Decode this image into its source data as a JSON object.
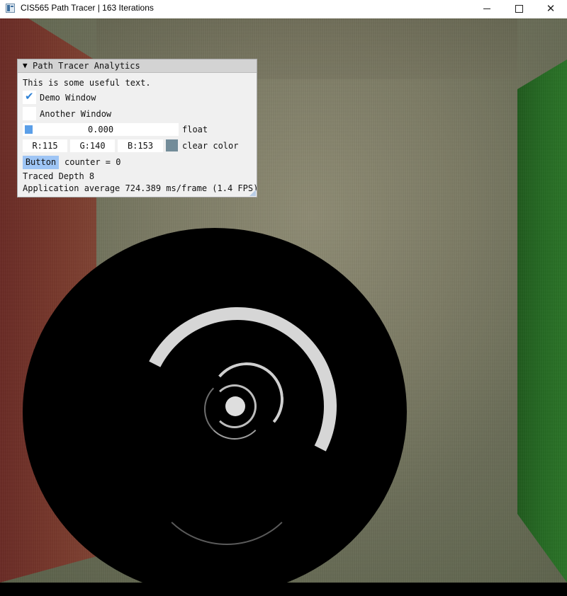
{
  "window": {
    "title": "CIS565 Path Tracer | 163 Iterations",
    "controls": {
      "minimize": "",
      "maximize": "",
      "close": "✕"
    }
  },
  "panel": {
    "title": "Path Tracer Analytics",
    "text": "This is some useful text.",
    "demo_window": {
      "label": "Demo Window",
      "checked": true
    },
    "another_window": {
      "label": "Another Window",
      "checked": false
    },
    "slider": {
      "value": "0.000",
      "label": "float"
    },
    "clear_color": {
      "r": "R:115",
      "g": "G:140",
      "b": "B:153",
      "label": "clear color",
      "swatch": "#738c99"
    },
    "button_label": "Button",
    "counter_text": "counter = 0",
    "traced_depth": "Traced Depth 8",
    "fps_text": "Application average 724.389 ms/frame (1.4 FPS)"
  },
  "colors": {
    "accent": "#5b9fe8",
    "check": "#2f82d6",
    "button": "#9ec5f5",
    "left_wall": "#7a3a2c",
    "right_wall": "#246a22"
  }
}
